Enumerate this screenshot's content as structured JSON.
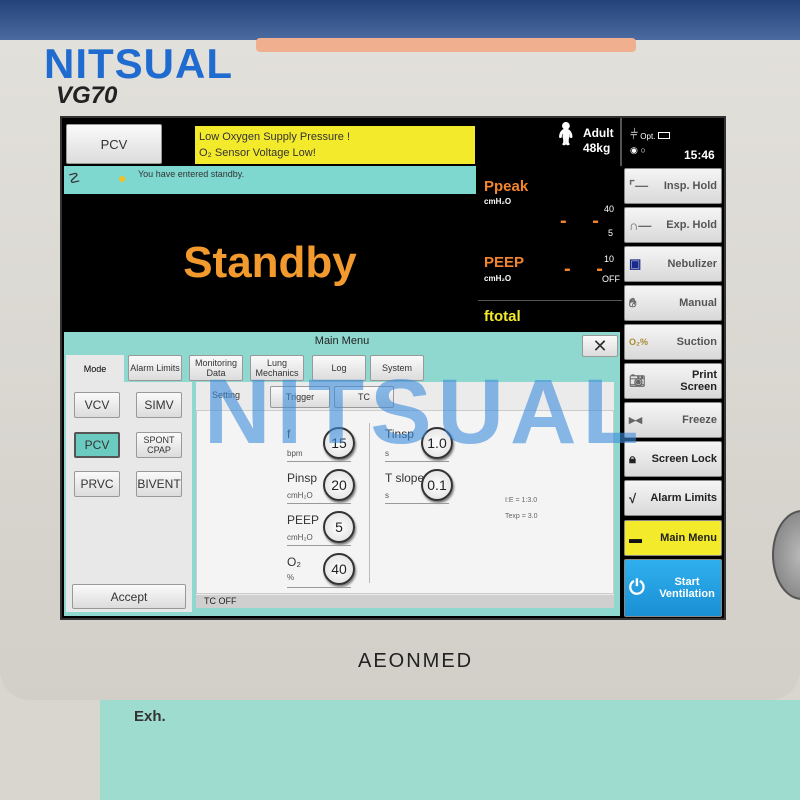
{
  "device": {
    "brand": "NITSUAL",
    "model": "VG70",
    "manufacturer": "AEONMED",
    "port_label": "Exh."
  },
  "watermark": "NITSUAL",
  "top": {
    "mode": "PCV",
    "alarms": [
      "Low Oxygen Supply Pressure !",
      "O₂ Sensor Voltage Low!"
    ],
    "patient_type": "Adult",
    "weight": "48kg",
    "power_label": "Opt.",
    "time": "15:46"
  },
  "standby": {
    "message": "You have entered standby.",
    "title": "Standby"
  },
  "monitor": {
    "ppeak": {
      "label": "Ppeak",
      "unit": "cmH₂O",
      "value": "- -",
      "high": "40",
      "low": "5"
    },
    "peep": {
      "label": "PEEP",
      "unit": "cmH₂O",
      "value": "- -",
      "high": "10",
      "low": "OFF"
    },
    "ftotal": {
      "label": "ftotal"
    }
  },
  "side_buttons": [
    {
      "label": "Insp. Hold",
      "icon": "insp-hold-icon"
    },
    {
      "label": "Exp. Hold",
      "icon": "exp-hold-icon"
    },
    {
      "label": "Nebulizer",
      "icon": "nebulizer-icon"
    },
    {
      "label": "Manual",
      "icon": "hand-icon"
    },
    {
      "label": "Suction",
      "icon": "suction-icon"
    },
    {
      "label": "Print Screen",
      "icon": "camera-icon"
    },
    {
      "label": "Freeze",
      "icon": "freeze-icon"
    },
    {
      "label": "Screen Lock",
      "icon": "lock-icon"
    },
    {
      "label": "Alarm Limits",
      "icon": "alarm-limits-icon"
    },
    {
      "label": "Main Menu",
      "icon": "menu-icon"
    },
    {
      "label": "Start Ventilation",
      "icon": "power-icon"
    }
  ],
  "colors": {
    "alarm": "#f4ea2c",
    "accent": "#8fd8cf",
    "main_menu_button": "#f4ea2c",
    "start_button": "#1e9ee0",
    "value_orange": "#f3852e",
    "ftotal_yellow": "#f4ea2c"
  },
  "main_menu": {
    "title": "Main Menu",
    "tabs": [
      "Mode",
      "Alarm Limits",
      "Monitoring Data",
      "Lung Mechanics",
      "Log",
      "System"
    ],
    "active_tab": "Mode",
    "modes": [
      "VCV",
      "SIMV",
      "PCV",
      "SPONT CPAP",
      "PRVC",
      "BIVENT"
    ],
    "selected_mode": "PCV",
    "accept": "Accept",
    "subtabs": [
      "Setting",
      "Trigger",
      "TC"
    ],
    "active_subtab": "Setting",
    "params_left": [
      {
        "label": "f",
        "unit": "bpm",
        "value": "15"
      },
      {
        "label": "Pinsp",
        "unit": "cmH₂O",
        "value": "20"
      },
      {
        "label": "PEEP",
        "unit": "cmH₂O",
        "value": "5"
      },
      {
        "label": "O₂",
        "unit": "%",
        "value": "40"
      }
    ],
    "params_right": [
      {
        "label": "Tinsp",
        "unit": "s",
        "value": "1.0"
      },
      {
        "label": "T slope",
        "unit": "s",
        "value": "0.1"
      }
    ],
    "ie": "I:E = 1:3.0",
    "texp": "Texp = 3.0",
    "status": "TC OFF"
  }
}
